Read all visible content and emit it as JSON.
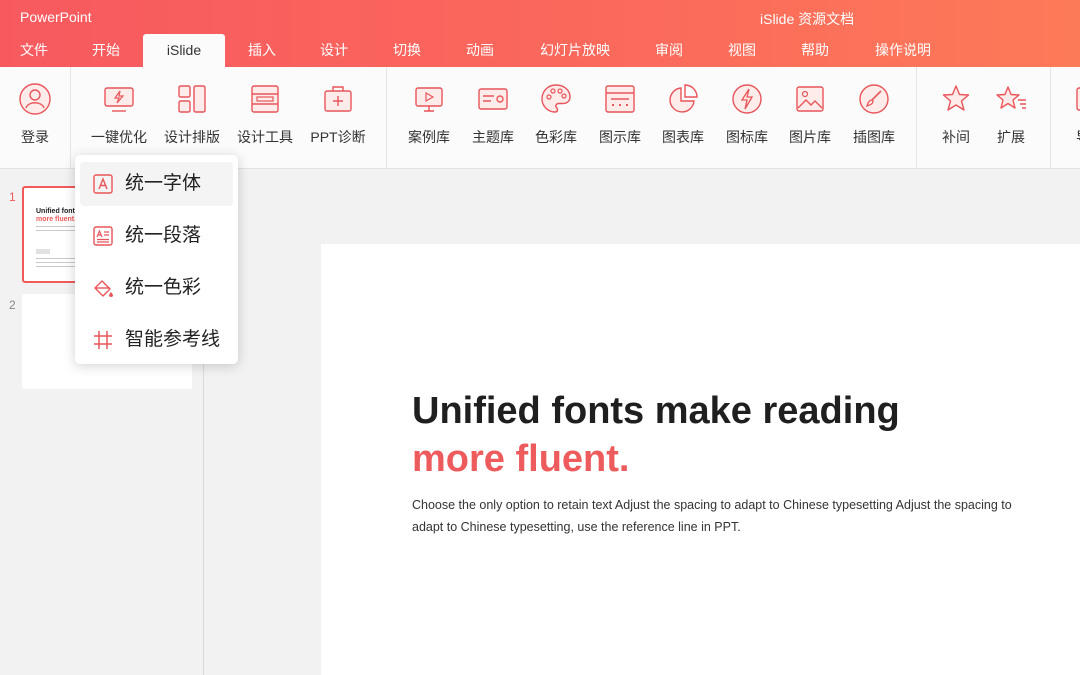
{
  "window": {
    "app_name": "PowerPoint",
    "doc_title": "iSlide 资源文档"
  },
  "tabs": [
    {
      "label": "文件"
    },
    {
      "label": "开始"
    },
    {
      "label": "iSlide"
    },
    {
      "label": "插入"
    },
    {
      "label": "设计"
    },
    {
      "label": "切换"
    },
    {
      "label": "动画"
    },
    {
      "label": "幻灯片放映"
    },
    {
      "label": "审阅"
    },
    {
      "label": "视图"
    },
    {
      "label": "帮助"
    },
    {
      "label": "操作说明"
    }
  ],
  "active_tab": "iSlide",
  "ribbon": [
    {
      "label": "登录",
      "icon": "user-icon"
    },
    {
      "label": "一键优化",
      "icon": "monitor-bolt-icon"
    },
    {
      "label": "设计排版",
      "icon": "layout-icon"
    },
    {
      "label": "设计工具",
      "icon": "tools-layout-icon"
    },
    {
      "label": "PPT诊断",
      "icon": "medical-kit-icon"
    },
    {
      "label": "案例库",
      "icon": "presentation-play-icon"
    },
    {
      "label": "主题库",
      "icon": "theme-card-icon"
    },
    {
      "label": "色彩库",
      "icon": "palette-icon"
    },
    {
      "label": "图示库",
      "icon": "diagram-icon"
    },
    {
      "label": "图表库",
      "icon": "pie-chart-icon"
    },
    {
      "label": "图标库",
      "icon": "bolt-circle-icon"
    },
    {
      "label": "图片库",
      "icon": "image-icon"
    },
    {
      "label": "插图库",
      "icon": "brush-circle-icon"
    },
    {
      "label": "补间",
      "icon": "star-icon"
    },
    {
      "label": "扩展",
      "icon": "star-lines-icon"
    },
    {
      "label": "导",
      "icon": "partial-icon"
    }
  ],
  "dropdown": [
    {
      "label": "统一字体",
      "icon": "font-a-icon"
    },
    {
      "label": "统一段落",
      "icon": "paragraph-icon"
    },
    {
      "label": "统一色彩",
      "icon": "paint-bucket-icon"
    },
    {
      "label": "智能参考线",
      "icon": "grid-hash-icon"
    }
  ],
  "thumbnails": [
    {
      "number": "1",
      "title_line1": "Unified fonts m",
      "title_line2": "more fluent.",
      "tag": "Text here"
    },
    {
      "number": "2"
    }
  ],
  "slide": {
    "title_line1": "Unified fonts make reading",
    "title_line2": "more fluent.",
    "body": "Choose the only option to retain text Adjust the spacing to adapt to Chinese typesetting Adjust the spacing to adapt to Chinese typesetting, use the reference line in PPT."
  },
  "colors": {
    "accent": "#F05A5A",
    "topbar_start": "#F7595F",
    "topbar_end": "#FD7A58",
    "icon_stroke": "#E8555A"
  }
}
